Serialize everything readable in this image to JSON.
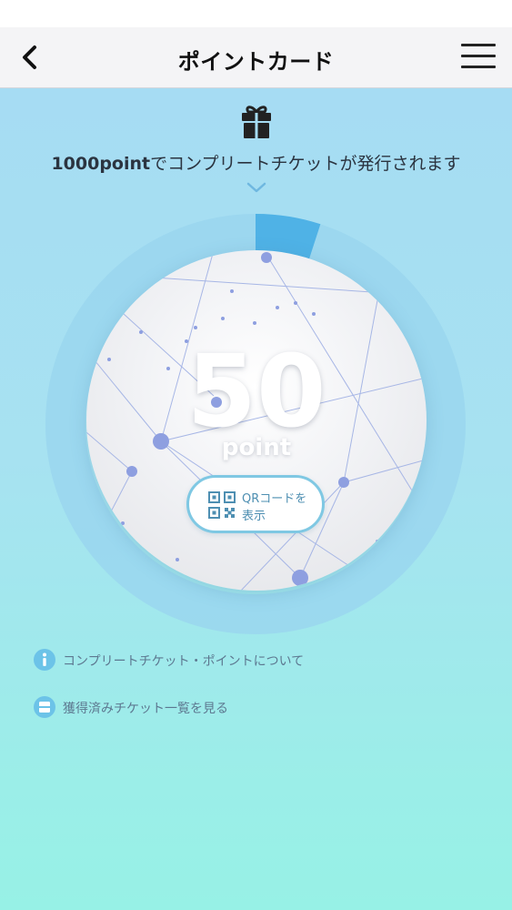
{
  "nav": {
    "title": "ポイントカード",
    "back_icon": "chevron-left-icon",
    "menu_icon": "hamburger-menu-icon"
  },
  "promo": {
    "icon": "gift-icon",
    "bold_text": "1000point",
    "text": "でコンプリートチケットが発行されます",
    "chevron_icon": "chevron-down-icon"
  },
  "points": {
    "value": "50",
    "unit": "point",
    "goal": 1000,
    "progress_fraction": 0.05
  },
  "qr_button": {
    "icon": "qr-code-icon",
    "label_line1": "QRコードを",
    "label_line2": "表示"
  },
  "links": [
    {
      "icon": "info-icon",
      "label": "コンプリートチケット・ポイントについて"
    },
    {
      "icon": "ticket-icon",
      "label": "獲得済みチケット一覧を見る"
    }
  ],
  "colors": {
    "progress": "#4fb2e6",
    "ring_track": "#9ad6ef",
    "link_icon": "#6cc3e8",
    "qr_border": "#7fc8e3"
  }
}
